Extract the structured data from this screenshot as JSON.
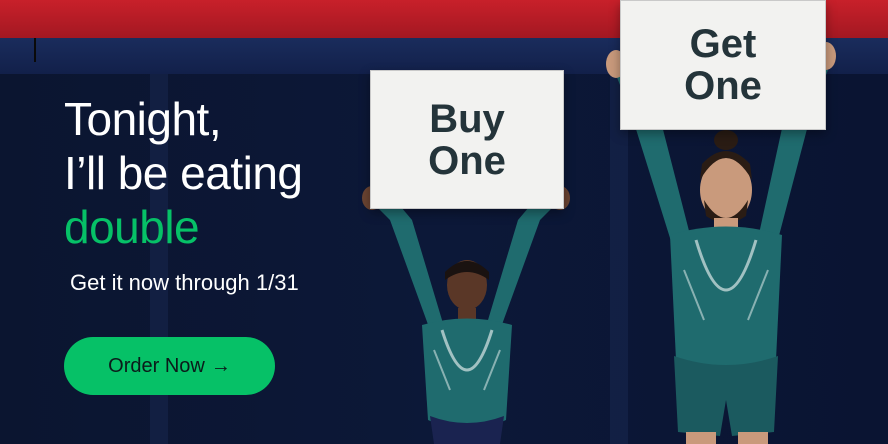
{
  "banner": {
    "headline_line1": "Tonight,",
    "headline_line2": "I’ll be eating",
    "headline_accent": "double",
    "subline": "Get it now through 1/31",
    "cta_label": "Order Now",
    "cta_icon": "arrow-right-icon",
    "cta_arrow": "→"
  },
  "signs": {
    "left_line1": "Buy",
    "left_line2": "One",
    "right_line1": "Get",
    "right_line2": "One"
  },
  "colors": {
    "accent_green": "#06c167",
    "background_navy": "#0b1530",
    "top_red": "#c8202a",
    "leotard_teal": "#1f6b6e"
  }
}
